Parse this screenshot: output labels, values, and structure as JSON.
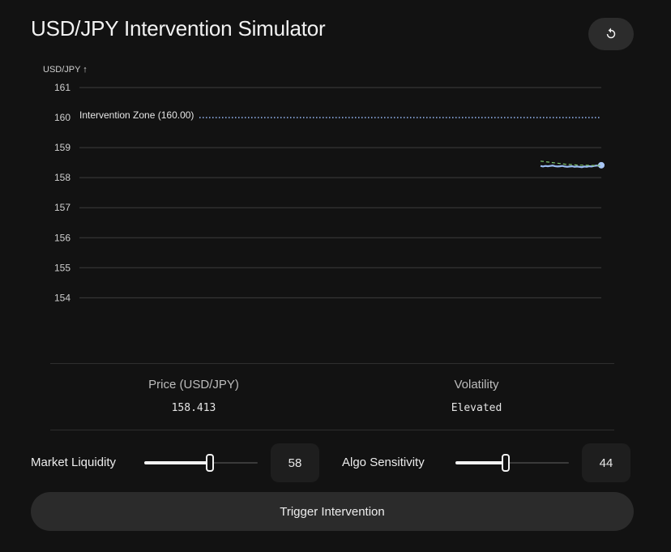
{
  "app": {
    "title": "USD/JPY Intervention Simulator"
  },
  "toolbar": {
    "reset_icon": "reset-icon"
  },
  "chart_data": {
    "type": "line",
    "ylabel": "USD/JPY ↑",
    "ylim": [
      153.7,
      161
    ],
    "yticks": [
      "161",
      "160",
      "159",
      "158",
      "157",
      "156",
      "155",
      "154"
    ],
    "grid": true,
    "reference_line": {
      "value": 160.0,
      "label": "Intervention Zone (160.00)"
    },
    "series": [
      {
        "style": "solid",
        "color": "#9bbcf0",
        "x": [
          0,
          1,
          2,
          3,
          4,
          5,
          6,
          7,
          8,
          9,
          10,
          11,
          12,
          13,
          14,
          15,
          16,
          17,
          18,
          19,
          20,
          21,
          22,
          23,
          24,
          25
        ],
        "values": [
          158.39,
          158.37,
          158.39,
          158.38,
          158.39,
          158.4,
          158.38,
          158.37,
          158.38,
          158.39,
          158.37,
          158.36,
          158.37,
          158.38,
          158.36,
          158.37,
          158.36,
          158.35,
          158.37,
          158.36,
          158.38,
          158.37,
          158.39,
          158.4,
          158.4,
          158.413
        ]
      },
      {
        "style": "dashed",
        "color": "#7fc36b",
        "x": [
          0,
          5,
          10,
          15,
          20,
          25
        ],
        "values": [
          158.55,
          158.5,
          158.45,
          158.42,
          158.41,
          158.4
        ]
      }
    ]
  },
  "stats": {
    "price_label": "Price (USD/JPY)",
    "price_value": "158.413",
    "volatility_label": "Volatility",
    "volatility_value": "Elevated"
  },
  "controls": {
    "liquidity": {
      "label": "Market Liquidity",
      "value": "58",
      "fraction": 0.58
    },
    "algo": {
      "label": "Algo Sensitivity",
      "value": "44",
      "fraction": 0.44
    }
  },
  "actions": {
    "trigger_label": "Trigger Intervention"
  }
}
